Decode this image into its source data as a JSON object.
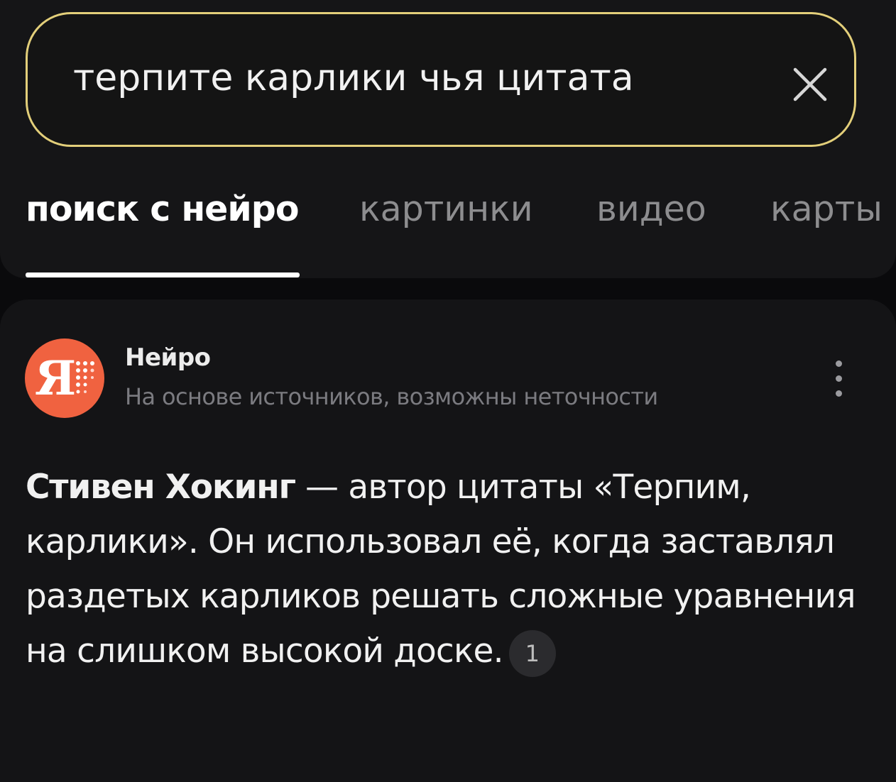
{
  "search": {
    "query": "терпите карлики чья цитата"
  },
  "tabs": [
    {
      "label": "поиск с нейро",
      "active": true
    },
    {
      "label": "картинки",
      "active": false
    },
    {
      "label": "видео",
      "active": false
    },
    {
      "label": "карты",
      "active": false
    }
  ],
  "answer": {
    "source_name": "Нейро",
    "disclaimer": "На основе источников, возможны неточности",
    "avatar_letter": "Я",
    "bold_subject": "Стивен Хокинг",
    "body": " — автор цитаты «Терпим, карлики». Он использовал её, когда заставлял раздетых карликов решать сложные уравнения на слишком высокой доске.",
    "source_count": "1"
  },
  "colors": {
    "background": "#0a0a0c",
    "panel": "#151517",
    "search_border": "#e3cf7a",
    "avatar": "#f06240",
    "tab_inactive": "#8d8d8f",
    "muted_text": "#7b7b80"
  },
  "icons": {
    "clear": "close-icon",
    "more": "more-vertical-icon",
    "avatar": "neiro-logo-icon"
  }
}
